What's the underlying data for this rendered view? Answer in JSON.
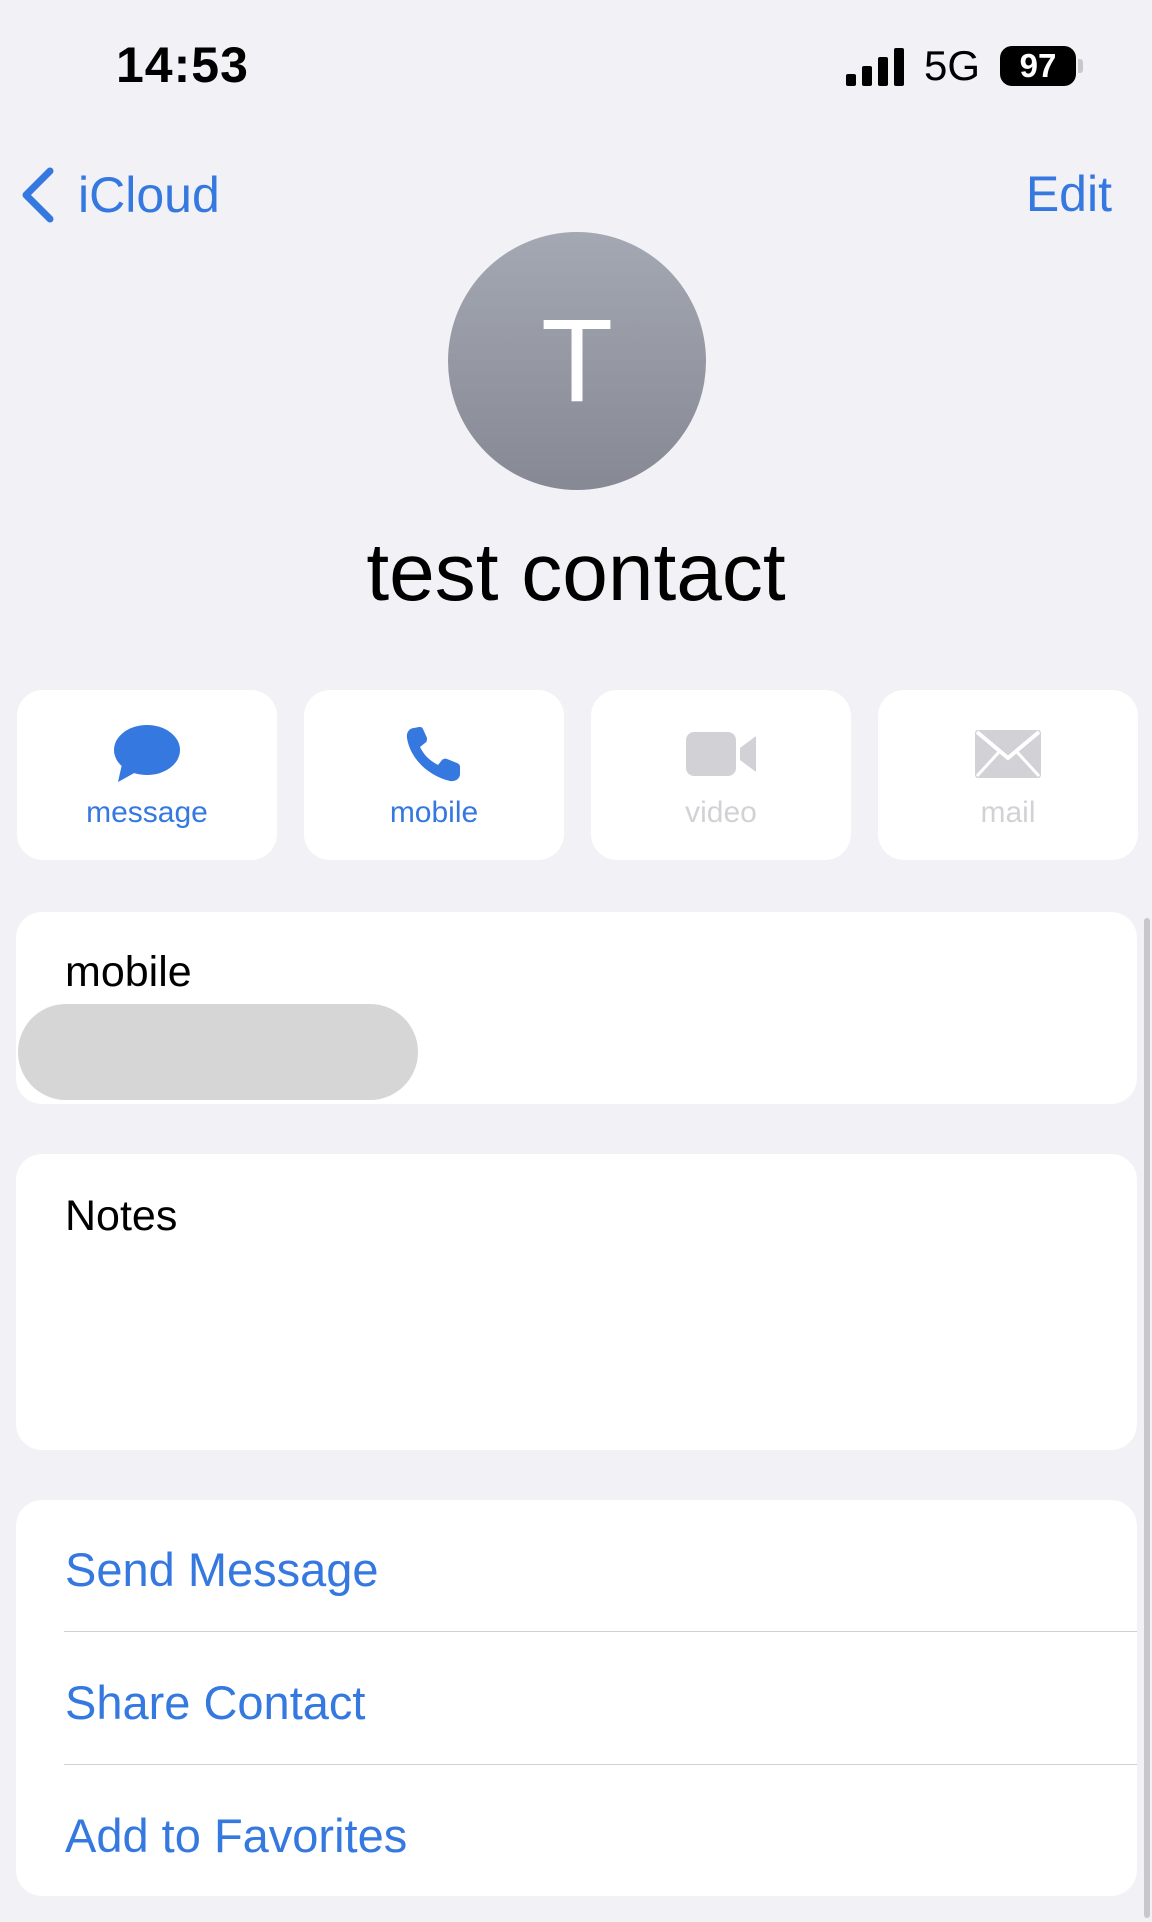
{
  "status_bar": {
    "time": "14:53",
    "network": "5G",
    "battery": "97"
  },
  "nav": {
    "back_label": "iCloud",
    "edit_label": "Edit"
  },
  "contact": {
    "initial": "T",
    "name": "test contact"
  },
  "actions": [
    {
      "label": "message",
      "icon": "message-bubble-icon",
      "enabled": true
    },
    {
      "label": "mobile",
      "icon": "phone-icon",
      "enabled": true
    },
    {
      "label": "video",
      "icon": "video-camera-icon",
      "enabled": false
    },
    {
      "label": "mail",
      "icon": "envelope-icon",
      "enabled": false
    }
  ],
  "phone_section": {
    "label": "mobile"
  },
  "notes_section": {
    "label": "Notes"
  },
  "links": {
    "send_message": "Send Message",
    "share_contact": "Share Contact",
    "add_favorites": "Add to Favorites"
  },
  "colors": {
    "accent": "#3478e0",
    "background": "#f1f1f6",
    "disabled": "#d2d2d6"
  }
}
